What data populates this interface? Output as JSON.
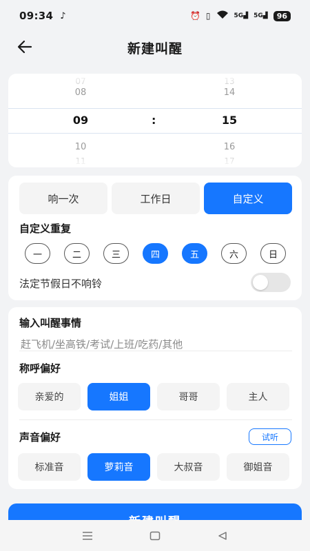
{
  "status_bar": {
    "time": "09:34",
    "battery": "96",
    "signal_1": "5G",
    "signal_2": "5G",
    "icons": [
      "tiktok-icon",
      "alarm-icon",
      "vibrate-icon",
      "wifi-icon",
      "signal-icon",
      "battery-icon"
    ]
  },
  "header": {
    "title": "新建叫醒"
  },
  "time_picker": {
    "hour": {
      "far_above": "07",
      "above": "08",
      "selected": "09",
      "below": "10",
      "far_below": "11"
    },
    "separator": ":",
    "minute": {
      "far_above": "13",
      "above": "14",
      "selected": "15",
      "below": "16",
      "far_below": "17"
    }
  },
  "repeat": {
    "modes": [
      {
        "label": "响一次",
        "active": false
      },
      {
        "label": "工作日",
        "active": false
      },
      {
        "label": "自定义",
        "active": true
      }
    ],
    "custom_title": "自定义重复",
    "weekdays": [
      {
        "label": "一",
        "on": false
      },
      {
        "label": "二",
        "on": false
      },
      {
        "label": "三",
        "on": false
      },
      {
        "label": "四",
        "on": true
      },
      {
        "label": "五",
        "on": true
      },
      {
        "label": "六",
        "on": false
      },
      {
        "label": "日",
        "on": false
      }
    ],
    "holiday_label": "法定节假日不响铃",
    "holiday_toggle_on": false
  },
  "event": {
    "title": "输入叫醒事情",
    "input_value": "",
    "input_placeholder": "赶飞机/坐高铁/考试/上班/吃药/其他"
  },
  "address": {
    "title": "称呼偏好",
    "options": [
      {
        "label": "亲爱的",
        "active": false
      },
      {
        "label": "姐姐",
        "active": true
      },
      {
        "label": "哥哥",
        "active": false
      },
      {
        "label": "主人",
        "active": false
      }
    ]
  },
  "voice": {
    "title": "声音偏好",
    "try_label": "试听",
    "options": [
      {
        "label": "标准音",
        "active": false
      },
      {
        "label": "萝莉音",
        "active": true
      },
      {
        "label": "大叔音",
        "active": false
      },
      {
        "label": "御姐音",
        "active": false
      }
    ]
  },
  "submit_label": "新建叫醒",
  "colors": {
    "accent": "#1677ff",
    "chip_bg": "#f4f4f4",
    "page_bg": "#f2f3f5"
  }
}
